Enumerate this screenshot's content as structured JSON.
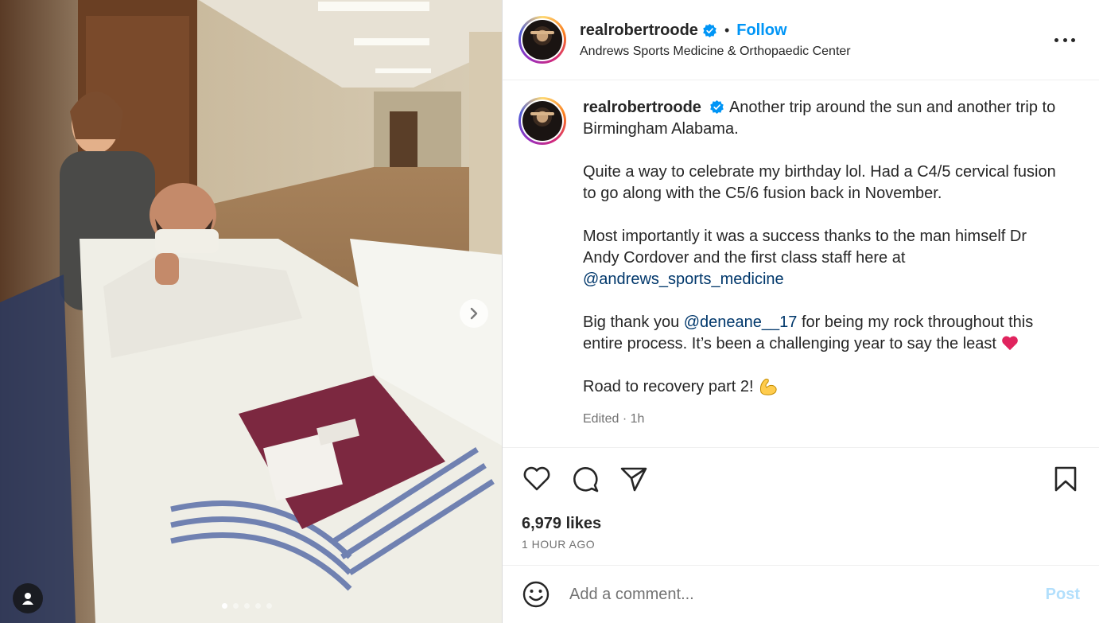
{
  "post": {
    "username": "realrobertroode",
    "follow_label": "Follow",
    "separator": "•",
    "location": "Andrews Sports Medicine & Orthopaedic Center",
    "caption": {
      "p1": "Another trip around the sun and another trip to Birmingham Alabama.",
      "p2": "Quite a way to celebrate my birthday lol. Had a C4/5 cervical fusion to go along with the C5/6 fusion back in November.",
      "p3_text": "Most importantly it was a success thanks to the man himself Dr Andy Cordover and the first class staff here at",
      "p3_mention": "@andrews_sports_medicine",
      "p4_pre": "Big thank you ",
      "p4_mention": "@deneane__17",
      "p4_post": " for being my rock throughout this entire process. It’s been a challenging year to say the least",
      "p5": "Road to recovery part 2!",
      "meta": "Edited · 1h"
    },
    "likes": "6,979 likes",
    "time": "1 HOUR AGO",
    "comment_placeholder": "Add a comment...",
    "post_label": "Post",
    "carousel": {
      "count": 5,
      "active_index": 0
    }
  },
  "icons": {
    "header_more": "more-horizontal-icon",
    "verified": "verified-badge-icon",
    "like": "heart-outline-icon",
    "comment": "comment-icon",
    "share": "paper-plane-icon",
    "save": "bookmark-icon",
    "emoji": "smiley-icon",
    "next": "chevron-right-icon",
    "tag": "user-tag-icon"
  },
  "colors": {
    "accent": "#0095f6",
    "mention": "#00376b",
    "muted": "#737373",
    "heart_emoji": "#e0245e",
    "arm_emoji": "#ffcc4d"
  }
}
